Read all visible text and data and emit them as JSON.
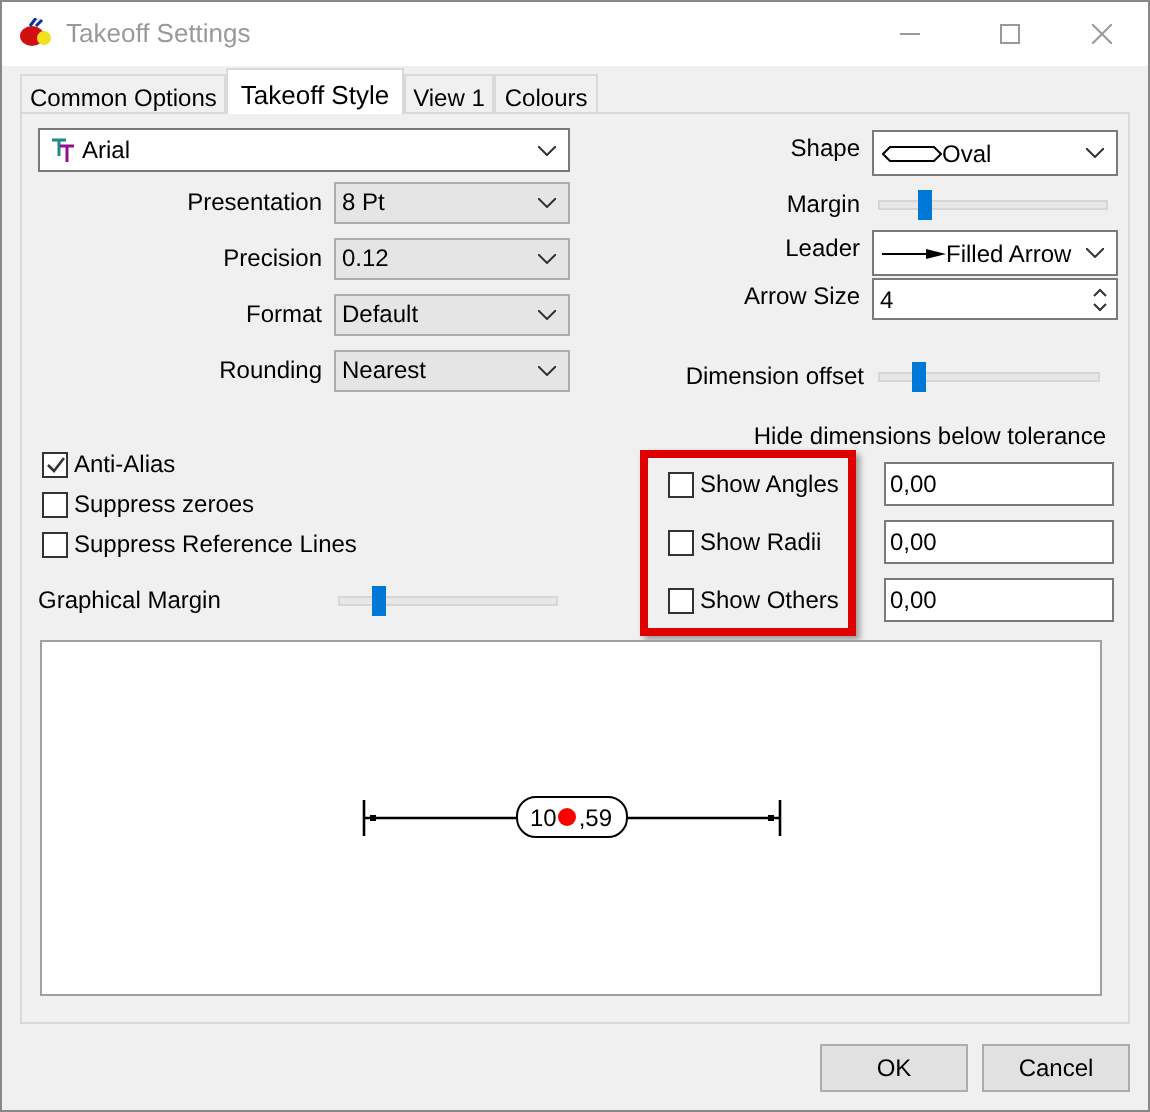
{
  "window": {
    "title": "Takeoff Settings"
  },
  "tabs": [
    {
      "label": "Common Options",
      "selected": false
    },
    {
      "label": "Takeoff Style",
      "selected": true
    },
    {
      "label": "View 1",
      "selected": false
    },
    {
      "label": "Colours",
      "selected": false
    }
  ],
  "font": {
    "value": "Arial"
  },
  "fields": [
    {
      "label": "Presentation",
      "value": "8 Pt"
    },
    {
      "label": "Precision",
      "value": "0.12"
    },
    {
      "label": "Format",
      "value": "Default"
    },
    {
      "label": "Rounding",
      "value": "Nearest"
    }
  ],
  "checkboxes": [
    {
      "label": "Anti-Alias",
      "checked": true
    },
    {
      "label": "Suppress zeroes",
      "checked": false
    },
    {
      "label": "Suppress Reference Lines",
      "checked": false
    }
  ],
  "graphical_margin": {
    "label": "Graphical Margin",
    "level": 0.18
  },
  "shape": {
    "label": "Shape",
    "value": "Oval"
  },
  "margin": {
    "label": "Margin",
    "level": 0.2
  },
  "leader": {
    "label": "Leader",
    "value": "Filled Arrow"
  },
  "arrow_size": {
    "label": "Arrow Size",
    "value": "4"
  },
  "dimension_offset": {
    "label": "Dimension offset",
    "level": 0.18
  },
  "tolerance": {
    "heading": "Hide dimensions below tolerance",
    "rows": [
      {
        "label": "Show Angles",
        "checked": false,
        "value": "0,00"
      },
      {
        "label": "Show Radii",
        "checked": false,
        "value": "0,00"
      },
      {
        "label": "Show Others",
        "checked": false,
        "value": "0,00"
      }
    ]
  },
  "preview": {
    "text_before": "10",
    "text_after": ",59"
  },
  "buttons": [
    "OK",
    "Cancel"
  ]
}
